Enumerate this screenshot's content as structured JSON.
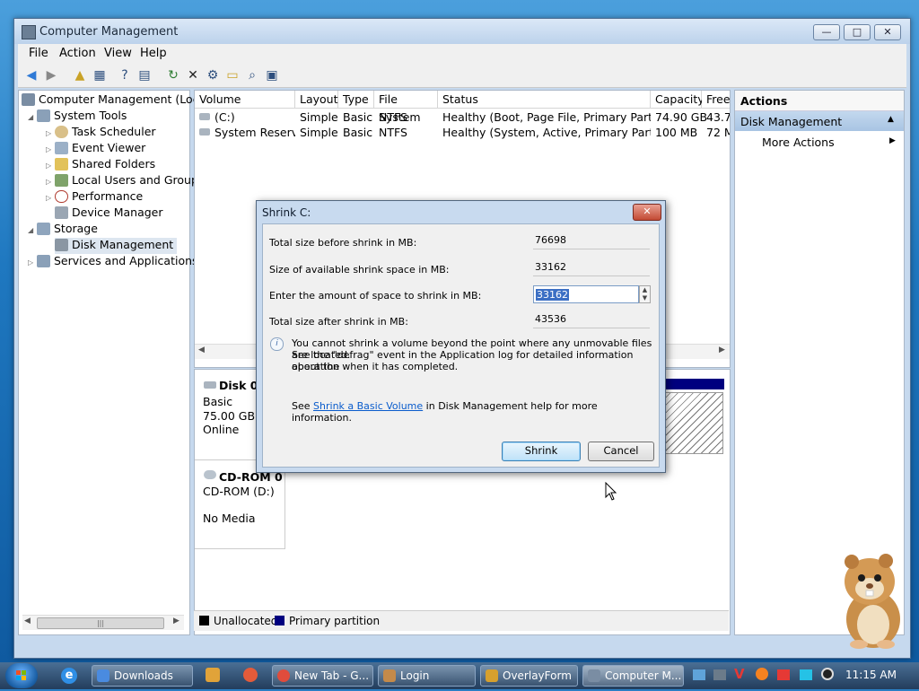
{
  "window": {
    "title": "Computer Management",
    "controls": {
      "minimize": "—",
      "maximize": "□",
      "close": "✕"
    }
  },
  "menu": [
    "File",
    "Action",
    "View",
    "Help"
  ],
  "toolbar": [
    "back-icon",
    "forward-icon",
    "up-folder-icon",
    "show-hide-tree-icon",
    "help-icon",
    "properties-icon",
    "refresh-icon",
    "delete-icon",
    "settings-icon",
    "open-icon",
    "search-icon",
    "export-icon"
  ],
  "tree": {
    "root": "Computer Management (Local",
    "items": [
      {
        "label": "System Tools",
        "level": 1,
        "expanded": true
      },
      {
        "label": "Task Scheduler",
        "level": 2
      },
      {
        "label": "Event Viewer",
        "level": 2
      },
      {
        "label": "Shared Folders",
        "level": 2
      },
      {
        "label": "Local Users and Groups",
        "level": 2
      },
      {
        "label": "Performance",
        "level": 2
      },
      {
        "label": "Device Manager",
        "level": 2
      },
      {
        "label": "Storage",
        "level": 1,
        "expanded": true
      },
      {
        "label": "Disk Management",
        "level": 2,
        "selected": true
      },
      {
        "label": "Services and Applications",
        "level": 1
      }
    ],
    "scroll_thumb": "|||"
  },
  "volumes": {
    "columns": [
      "Volume",
      "Layout",
      "Type",
      "File System",
      "Status",
      "Capacity",
      "Free"
    ],
    "rows": [
      [
        "(C:)",
        "Simple",
        "Basic",
        "NTFS",
        "Healthy (Boot, Page File, Primary Partition)",
        "74.90 GB",
        "43.7("
      ],
      [
        "System Reserved",
        "Simple",
        "Basic",
        "NTFS",
        "Healthy (System, Active, Primary Partition)",
        "100 MB",
        "72 M"
      ]
    ]
  },
  "disks": {
    "disk0": {
      "name": "Disk 0",
      "type": "Basic",
      "size": "75.00 GB",
      "state": "Online"
    },
    "cdrom0": {
      "name": "CD-ROM 0",
      "type": "CD-ROM (D:)",
      "state": "No Media"
    }
  },
  "legend": [
    {
      "label": "Unallocated",
      "color": "#000000"
    },
    {
      "label": "Primary partition",
      "color": "#00007f"
    }
  ],
  "actions": {
    "header": "Actions",
    "section": "Disk Management",
    "items": [
      "More Actions"
    ]
  },
  "dialog": {
    "title": "Shrink C:",
    "close": "✕",
    "fields": [
      {
        "label": "Total size before shrink in MB:",
        "value": "76698"
      },
      {
        "label": "Size of available shrink space in MB:",
        "value": "33162"
      },
      {
        "label": "Enter the amount of space to shrink in MB:",
        "value": "33162"
      },
      {
        "label": "Total size after shrink in MB:",
        "value": "43536"
      }
    ],
    "info_line1": "You cannot shrink a volume beyond the point where any unmovable files are located.",
    "info_line2": "See the \"defrag\" event in the Application log for detailed information about the",
    "info_line3": "operation when it has completed.",
    "help_prefix": "See",
    "help_link": "Shrink a Basic Volume",
    "help_suffix": "in Disk Management help for more information.",
    "shrink_button": "Shrink",
    "cancel_button": "Cancel"
  },
  "taskbar": {
    "items": [
      {
        "label": "Downloads"
      },
      {
        "label": "New Tab - G..."
      },
      {
        "label": "Login"
      },
      {
        "label": "OverlayForm"
      },
      {
        "label": "Computer M...",
        "active": true
      }
    ],
    "clock": "11:15 AM"
  }
}
